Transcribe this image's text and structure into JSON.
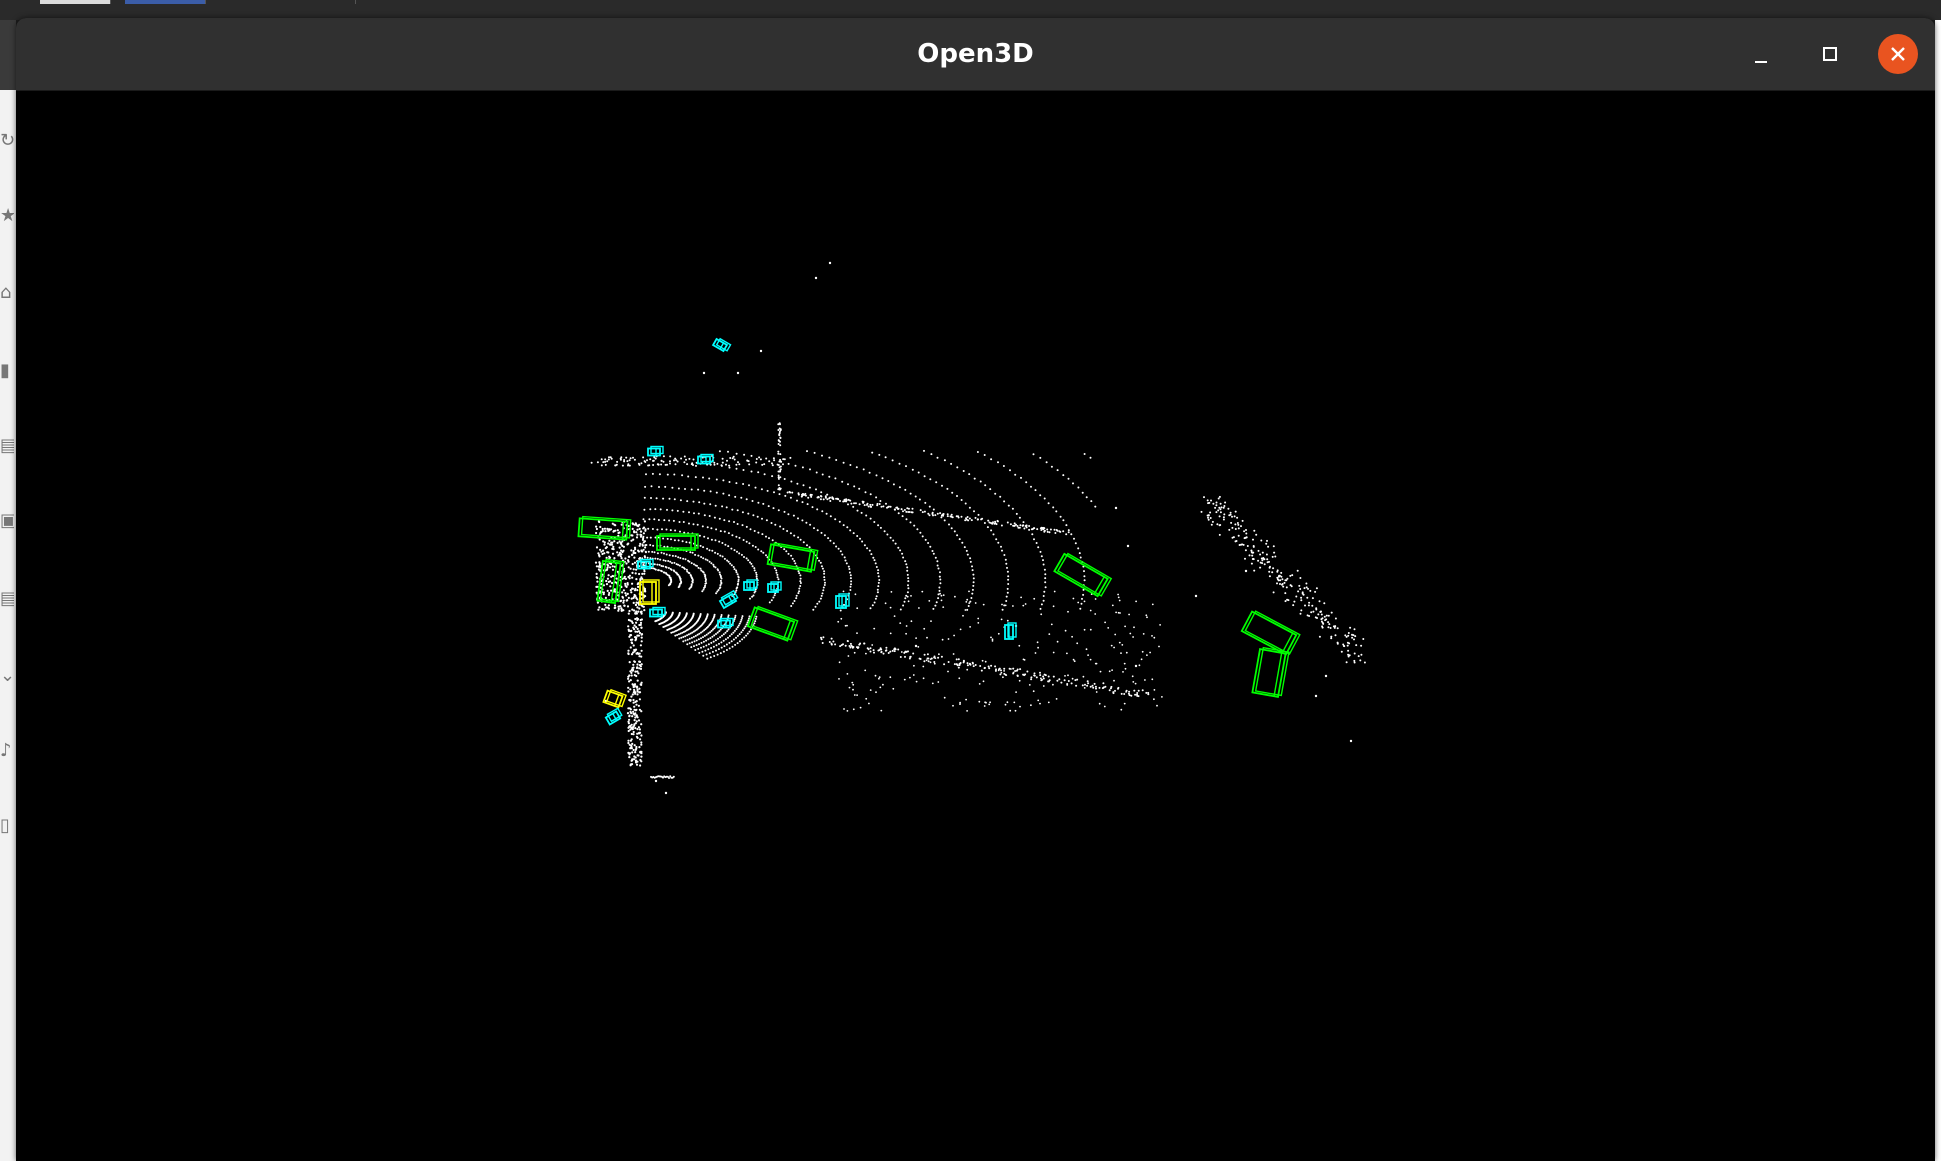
{
  "window": {
    "title": "Open3D",
    "controls": {
      "minimize": "minimize-icon",
      "maximize": "maximize-icon",
      "close": "close-icon"
    }
  },
  "viewport": {
    "background": "#000000",
    "point_color": "#ffffff",
    "box_colors": {
      "car": "#00ff00",
      "pedestrian": "#00ffff",
      "cyclist": "#ffff00"
    }
  },
  "colors": {
    "titlebar": "#303030",
    "close_button": "#e95420"
  }
}
